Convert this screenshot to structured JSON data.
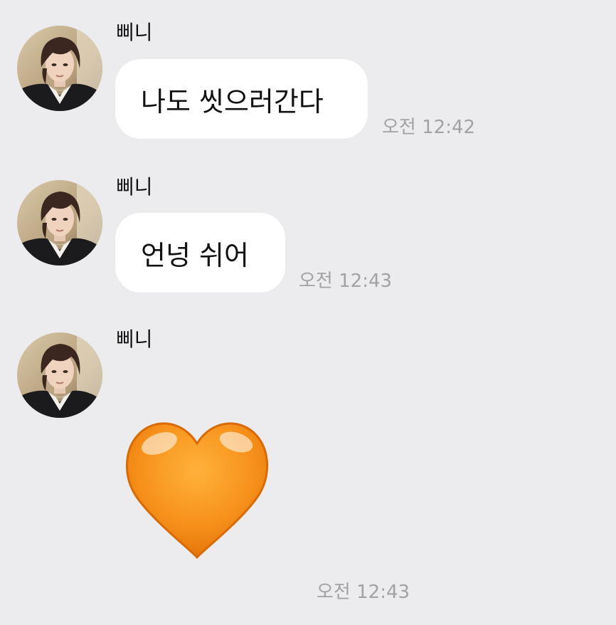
{
  "messages": [
    {
      "sender": "삐니",
      "text": "나도 씻으러간다",
      "time": "오전 12:42"
    },
    {
      "sender": "삐니",
      "text": "언넝 쉬어",
      "time": "오전 12:43"
    },
    {
      "sender": "삐니",
      "emoji": "orange-heart",
      "time": "오전 12:43"
    }
  ],
  "colors": {
    "background": "#ececee",
    "bubble": "#ffffff",
    "timestamp": "#a2a2a6",
    "heart": "#f08a10"
  }
}
